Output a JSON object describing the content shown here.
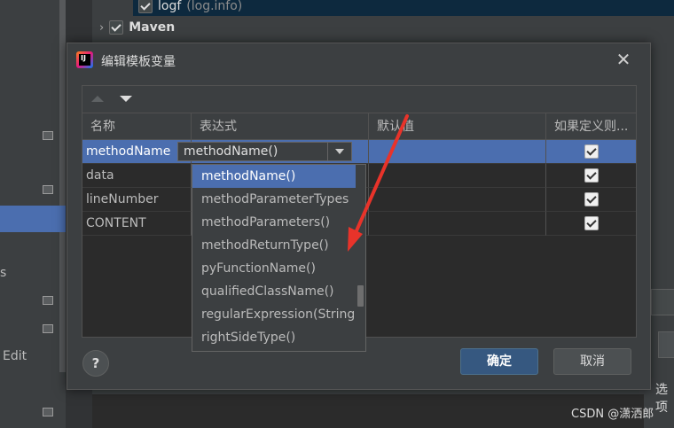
{
  "background": {
    "tree_item_logf": "logf",
    "tree_item_logf_hint": "(log.info)",
    "tree_item_maven": "Maven",
    "side_text_s": "s",
    "side_text_edit": "Edit",
    "right_text": "选项",
    "watermark": "CSDN @潇洒郎"
  },
  "dialog": {
    "title": "编辑模板变量",
    "columns": [
      "名称",
      "表达式",
      "默认值",
      "如果定义则..."
    ],
    "rows": [
      {
        "name": "methodName",
        "expression": "methodName()",
        "default": "",
        "skip_if_defined": true
      },
      {
        "name": "data",
        "expression": "",
        "default": "",
        "skip_if_defined": true
      },
      {
        "name": "lineNumber",
        "expression": "",
        "default": "",
        "skip_if_defined": true
      },
      {
        "name": "CONTENT",
        "expression": "",
        "default": "",
        "skip_if_defined": true
      }
    ],
    "combo_value": "methodName()",
    "dropdown_options": [
      "methodName()",
      "methodParameterTypes",
      "methodParameters()",
      "methodReturnType()",
      "pyFunctionName()",
      "qualifiedClassName()",
      "regularExpression(String",
      "rightSideType()"
    ],
    "help_label": "?",
    "ok_label": "确定",
    "cancel_label": "取消"
  },
  "colors": {
    "selection": "#4b6eaf",
    "annotation_arrow": "#e8332a"
  }
}
